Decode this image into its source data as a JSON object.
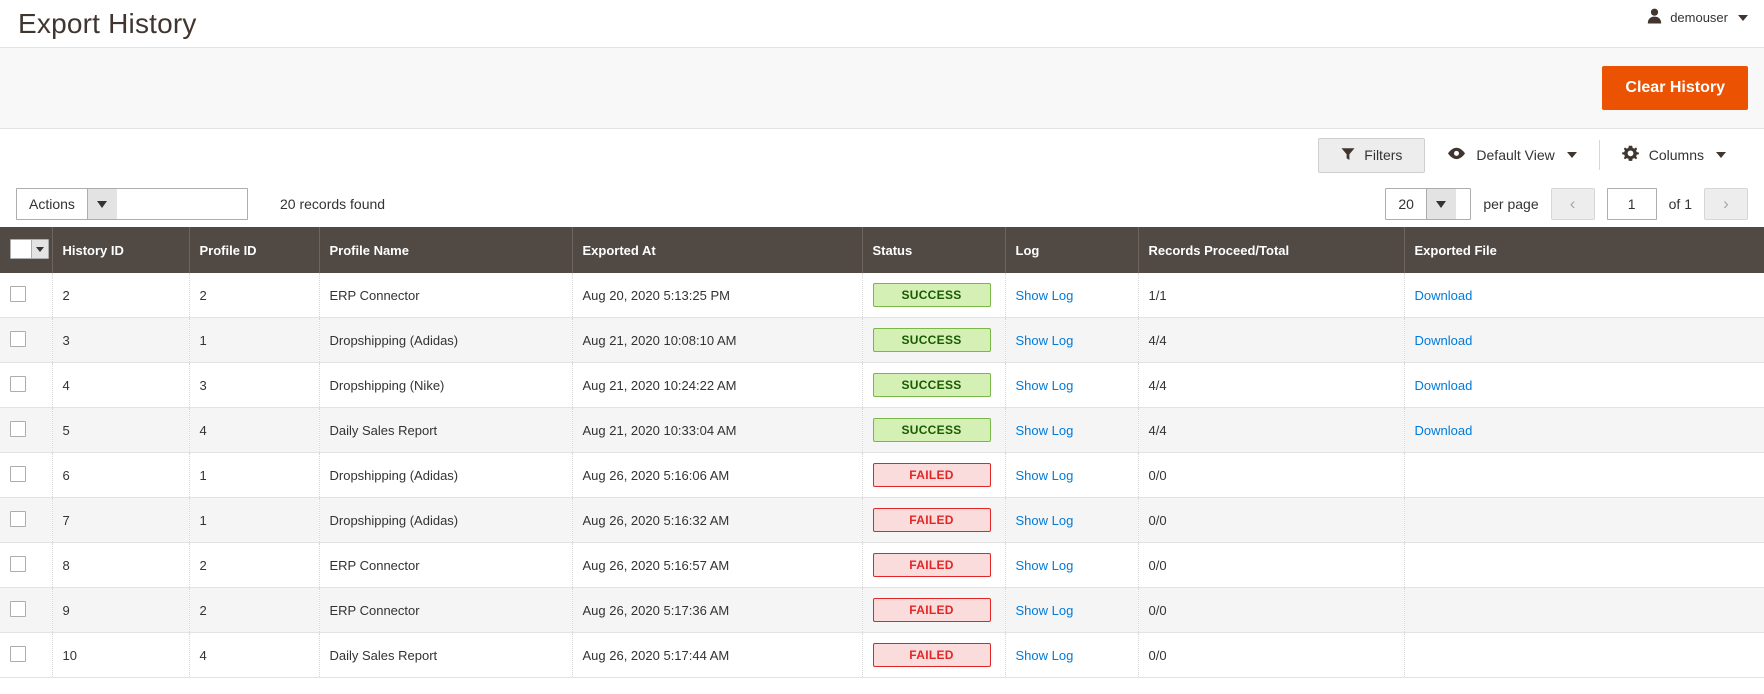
{
  "header": {
    "title": "Export History",
    "user": {
      "name": "demouser",
      "icon": "user-icon",
      "caret": "chevron-down-icon"
    }
  },
  "action_bar": {
    "clear_history_label": "Clear History",
    "accent_color": "#eb5202"
  },
  "grid_toolbar": {
    "filters_label": "Filters",
    "default_view_label": "Default View",
    "columns_label": "Columns"
  },
  "grid_controls": {
    "actions_label": "Actions",
    "records_found": "20 records found",
    "per_page_value": "20",
    "per_page_label": "per page",
    "page_value": "1",
    "of_label": "of 1",
    "prev_icon": "chevron-left-icon",
    "next_icon": "chevron-right-icon"
  },
  "table": {
    "columns": [
      "History ID",
      "Profile ID",
      "Profile Name",
      "Exported At",
      "Status",
      "Log",
      "Records Proceed/Total",
      "Exported File"
    ],
    "rows": [
      {
        "history_id": "2",
        "profile_id": "2",
        "profile_name": "ERP Connector",
        "exported_at": "Aug 20, 2020 5:13:25 PM",
        "status": "SUCCESS",
        "status_type": "success",
        "log": "Show Log",
        "records": "1/1",
        "file": "Download"
      },
      {
        "history_id": "3",
        "profile_id": "1",
        "profile_name": "Dropshipping (Adidas)",
        "exported_at": "Aug 21, 2020 10:08:10 AM",
        "status": "SUCCESS",
        "status_type": "success",
        "log": "Show Log",
        "records": "4/4",
        "file": "Download"
      },
      {
        "history_id": "4",
        "profile_id": "3",
        "profile_name": "Dropshipping (Nike)",
        "exported_at": "Aug 21, 2020 10:24:22 AM",
        "status": "SUCCESS",
        "status_type": "success",
        "log": "Show Log",
        "records": "4/4",
        "file": "Download"
      },
      {
        "history_id": "5",
        "profile_id": "4",
        "profile_name": "Daily Sales Report",
        "exported_at": "Aug 21, 2020 10:33:04 AM",
        "status": "SUCCESS",
        "status_type": "success",
        "log": "Show Log",
        "records": "4/4",
        "file": "Download"
      },
      {
        "history_id": "6",
        "profile_id": "1",
        "profile_name": "Dropshipping (Adidas)",
        "exported_at": "Aug 26, 2020 5:16:06 AM",
        "status": "FAILED",
        "status_type": "failed",
        "log": "Show Log",
        "records": "0/0",
        "file": ""
      },
      {
        "history_id": "7",
        "profile_id": "1",
        "profile_name": "Dropshipping (Adidas)",
        "exported_at": "Aug 26, 2020 5:16:32 AM",
        "status": "FAILED",
        "status_type": "failed",
        "log": "Show Log",
        "records": "0/0",
        "file": ""
      },
      {
        "history_id": "8",
        "profile_id": "2",
        "profile_name": "ERP Connector",
        "exported_at": "Aug 26, 2020 5:16:57 AM",
        "status": "FAILED",
        "status_type": "failed",
        "log": "Show Log",
        "records": "0/0",
        "file": ""
      },
      {
        "history_id": "9",
        "profile_id": "2",
        "profile_name": "ERP Connector",
        "exported_at": "Aug 26, 2020 5:17:36 AM",
        "status": "FAILED",
        "status_type": "failed",
        "log": "Show Log",
        "records": "0/0",
        "file": ""
      },
      {
        "history_id": "10",
        "profile_id": "4",
        "profile_name": "Daily Sales Report",
        "exported_at": "Aug 26, 2020 5:17:44 AM",
        "status": "FAILED",
        "status_type": "failed",
        "log": "Show Log",
        "records": "0/0",
        "file": ""
      }
    ]
  }
}
